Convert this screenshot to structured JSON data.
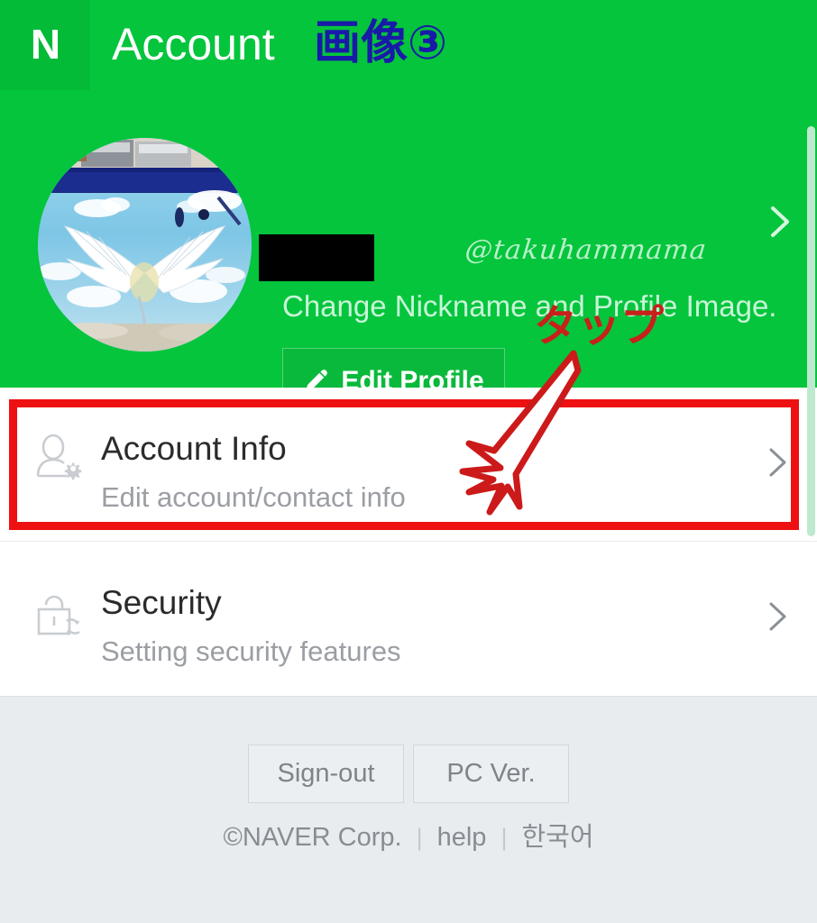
{
  "topbar": {
    "logo_letter": "N",
    "title": "Account",
    "annotation": "画像③"
  },
  "hero": {
    "handle": "@takuhammama",
    "nickname_redacted": "",
    "subtitle": "Change Nickname and Profile Image.",
    "edit_profile_label": "Edit Profile",
    "avatar_alt": "angel-wings-mural-photo",
    "chevron": "›"
  },
  "annotation": {
    "tap_label": "タップ",
    "highlight_color": "#ee1111",
    "arrow_color": "#cc1a1a"
  },
  "list": {
    "items": [
      {
        "icon": "person-gear-icon",
        "title": "Account Info",
        "subtitle": "Edit account/contact info",
        "chevron": "›"
      },
      {
        "icon": "lock-refresh-icon",
        "title": "Security",
        "subtitle": "Setting security features",
        "chevron": "›"
      }
    ]
  },
  "footer": {
    "buttons": [
      {
        "label": "Sign-out"
      },
      {
        "label": "PC Ver."
      }
    ],
    "copyright_symbol": "©",
    "copyright": "NAVER Corp.",
    "separator": "|",
    "help_label": "help",
    "language_label": "한국어"
  },
  "colors": {
    "brand_green": "#04c53c",
    "logo_green": "#04bb38",
    "button_green": "#09b93b",
    "annotation_blue": "#1a1aa8",
    "annotation_red": "#c8201b",
    "footer_bg": "#e8ecef"
  }
}
